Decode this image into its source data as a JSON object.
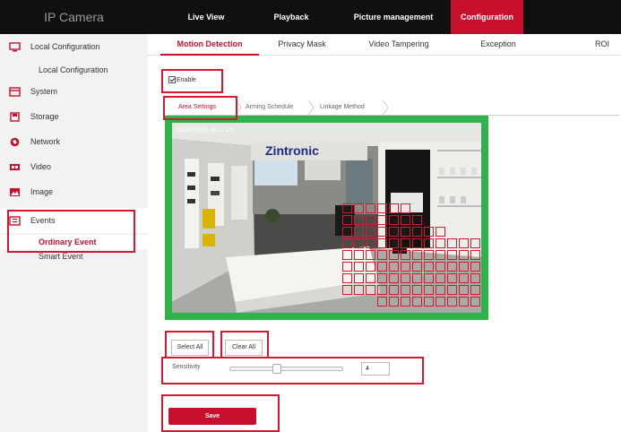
{
  "app": {
    "brand": "IP Camera"
  },
  "nav": {
    "tabs": [
      {
        "label": "Live View"
      },
      {
        "label": "Playback"
      },
      {
        "label": "Picture management"
      },
      {
        "label": "Configuration",
        "active": true
      }
    ]
  },
  "sidebar": {
    "items": [
      {
        "label": "Local Configuration",
        "icon": "monitor-icon"
      },
      {
        "label": "Local Configuration",
        "sub": true
      },
      {
        "label": "System",
        "icon": "system-icon"
      },
      {
        "label": "Storage",
        "icon": "storage-icon"
      },
      {
        "label": "Network",
        "icon": "network-icon"
      },
      {
        "label": "Video",
        "icon": "video-icon"
      },
      {
        "label": "Image",
        "icon": "image-icon"
      },
      {
        "label": "Events",
        "icon": "events-icon"
      },
      {
        "label": "Ordinary Event",
        "sub": true,
        "active": true
      },
      {
        "label": "Smart Event",
        "sub": true
      }
    ]
  },
  "subtabs": [
    {
      "label": "Motion Detection",
      "active": true
    },
    {
      "label": "Privacy Mask"
    },
    {
      "label": "Video Tampering"
    },
    {
      "label": "Exception"
    },
    {
      "label": "ROI"
    }
  ],
  "enable": {
    "label": "Enable",
    "checked": true
  },
  "steps": [
    {
      "label": "Area Settings",
      "active": true
    },
    {
      "label": "Arming Schedule"
    },
    {
      "label": "Linkage Method"
    }
  ],
  "video": {
    "overlay_text": "2016/02/05 16:11:10",
    "logo_text": "Zintronic"
  },
  "buttons": {
    "select_all": "Select All",
    "clear_all": "Clear All",
    "save": "Save"
  },
  "sensitivity": {
    "label": "Sensitivity",
    "value": "4",
    "fraction": 0.4
  },
  "colors": {
    "accent": "#c8102e",
    "frame": "#2fb24a",
    "annotation": "#d8182c"
  }
}
